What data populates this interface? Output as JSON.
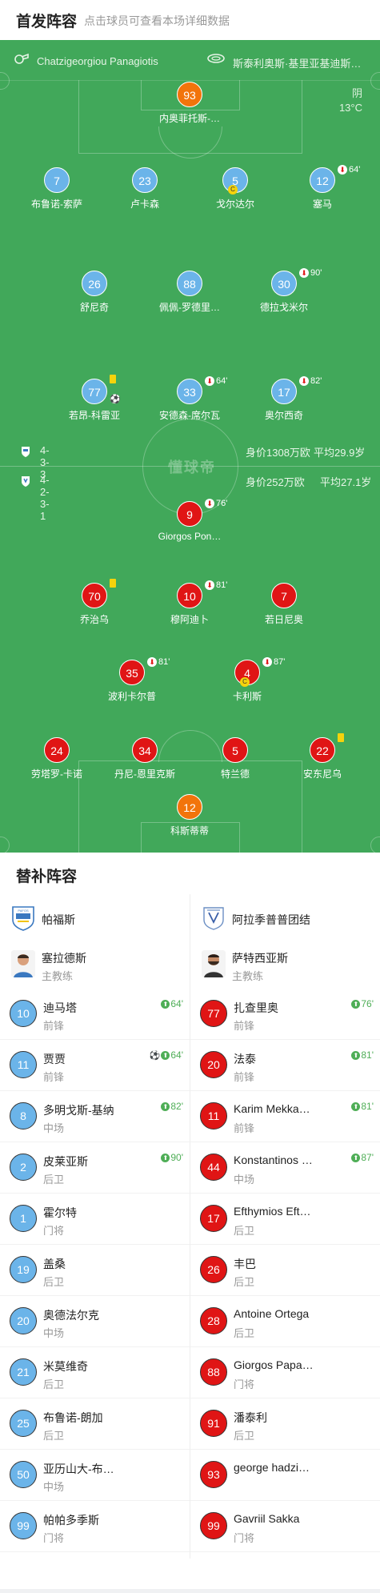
{
  "header": {
    "title": "首发阵容",
    "subtitle": "点击球员可查看本场详细数据"
  },
  "referee": {
    "name": "Chatzigeorgiou Panagiotis",
    "venue": "斯泰利奥斯·基里亚基迪斯…"
  },
  "weather": {
    "condition": "阴",
    "temp": "13°C"
  },
  "home": {
    "formation": "4-3-3",
    "market": "身价1308万欧",
    "avg_age": "平均29.9岁"
  },
  "away": {
    "formation": "4-2-3-1",
    "market": "身价252万欧",
    "avg_age": "平均27.1岁"
  },
  "watermark": "懂球帝",
  "home_players": [
    {
      "num": "93",
      "name": "内奥菲托斯-…",
      "color": "orange"
    },
    {
      "num": "7",
      "name": "布鲁诺-索萨",
      "color": "blue"
    },
    {
      "num": "23",
      "name": "卢卡森",
      "color": "blue"
    },
    {
      "num": "5",
      "name": "戈尔达尔",
      "color": "blue",
      "captain": true
    },
    {
      "num": "12",
      "name": "塞马",
      "color": "blue",
      "sub": "64'"
    },
    {
      "num": "26",
      "name": "舒尼奇",
      "color": "blue"
    },
    {
      "num": "88",
      "name": "佩佩-罗德里…",
      "color": "blue"
    },
    {
      "num": "30",
      "name": "德拉戈米尔",
      "color": "blue",
      "sub": "90'"
    },
    {
      "num": "77",
      "name": "若昂-科雷亚",
      "color": "blue",
      "yellow": true,
      "goal": true
    },
    {
      "num": "33",
      "name": "安德森-席尔瓦",
      "color": "blue",
      "sub": "64'"
    },
    {
      "num": "17",
      "name": "奥尔西奇",
      "color": "blue",
      "sub": "82'"
    }
  ],
  "away_players": [
    {
      "num": "9",
      "name": "Giorgos Pon…",
      "color": "red",
      "sub": "76'"
    },
    {
      "num": "70",
      "name": "乔治乌",
      "color": "red",
      "yellow": true
    },
    {
      "num": "10",
      "name": "穆阿迪卜",
      "color": "red",
      "sub": "81'"
    },
    {
      "num": "7",
      "name": "若日尼奥",
      "color": "red"
    },
    {
      "num": "35",
      "name": "波利卡尔普",
      "color": "red",
      "sub": "81'"
    },
    {
      "num": "4",
      "name": "卡利斯",
      "color": "red",
      "sub": "87'",
      "captain": true
    },
    {
      "num": "24",
      "name": "劳塔罗-卡诺",
      "color": "red"
    },
    {
      "num": "34",
      "name": "丹尼-恩里克斯",
      "color": "red"
    },
    {
      "num": "5",
      "name": "特兰德",
      "color": "red"
    },
    {
      "num": "22",
      "name": "安东尼乌",
      "color": "red",
      "yellow": true
    },
    {
      "num": "12",
      "name": "科斯蒂蒂",
      "color": "orange"
    }
  ],
  "subs": {
    "title": "替补阵容",
    "home": {
      "team": "帕福斯",
      "coach": {
        "name": "塞拉德斯",
        "role": "主教练"
      },
      "players": [
        {
          "num": "10",
          "name": "迪马塔",
          "pos": "前锋",
          "time": "64'"
        },
        {
          "num": "11",
          "name": "贾贾",
          "pos": "前锋",
          "time": "64'",
          "goal": true
        },
        {
          "num": "8",
          "name": "多明戈斯-基纳",
          "pos": "中场",
          "time": "82'"
        },
        {
          "num": "2",
          "name": "皮莱亚斯",
          "pos": "后卫",
          "time": "90'"
        },
        {
          "num": "1",
          "name": "霍尔特",
          "pos": "门将"
        },
        {
          "num": "19",
          "name": "盖桑",
          "pos": "后卫"
        },
        {
          "num": "20",
          "name": "奥德法尔克",
          "pos": "中场"
        },
        {
          "num": "21",
          "name": "米莫维奇",
          "pos": "后卫"
        },
        {
          "num": "25",
          "name": "布鲁诺-朗加",
          "pos": "后卫"
        },
        {
          "num": "50",
          "name": "亚历山大-布…",
          "pos": "中场"
        },
        {
          "num": "99",
          "name": "帕帕多季斯",
          "pos": "门将"
        }
      ]
    },
    "away": {
      "team": "阿拉季普普团结",
      "coach": {
        "name": "萨特西亚斯",
        "role": "主教练"
      },
      "players": [
        {
          "num": "77",
          "name": "扎查里奥",
          "pos": "前锋",
          "time": "76'"
        },
        {
          "num": "20",
          "name": "法泰",
          "pos": "前锋",
          "time": "81'"
        },
        {
          "num": "11",
          "name": "Karim Mekka…",
          "pos": "前锋",
          "time": "81'"
        },
        {
          "num": "44",
          "name": "Konstantinos …",
          "pos": "中场",
          "time": "87'"
        },
        {
          "num": "17",
          "name": "Efthymios Eft…",
          "pos": "后卫"
        },
        {
          "num": "26",
          "name": "丰巴",
          "pos": "后卫"
        },
        {
          "num": "28",
          "name": "Antoine Ortega",
          "pos": "后卫"
        },
        {
          "num": "88",
          "name": "Giorgos Papa…",
          "pos": "门将"
        },
        {
          "num": "91",
          "name": "潘泰利",
          "pos": "后卫"
        },
        {
          "num": "93",
          "name": "george hadzi…",
          "pos": ""
        },
        {
          "num": "99",
          "name": "Gavriil Sakka",
          "pos": "门将"
        }
      ]
    }
  },
  "colors": {
    "pitch": "#41a85a",
    "home": "#6bb4e9",
    "away": "#e01515",
    "gk": "#f2740b",
    "sub_green": "#4fae57"
  }
}
